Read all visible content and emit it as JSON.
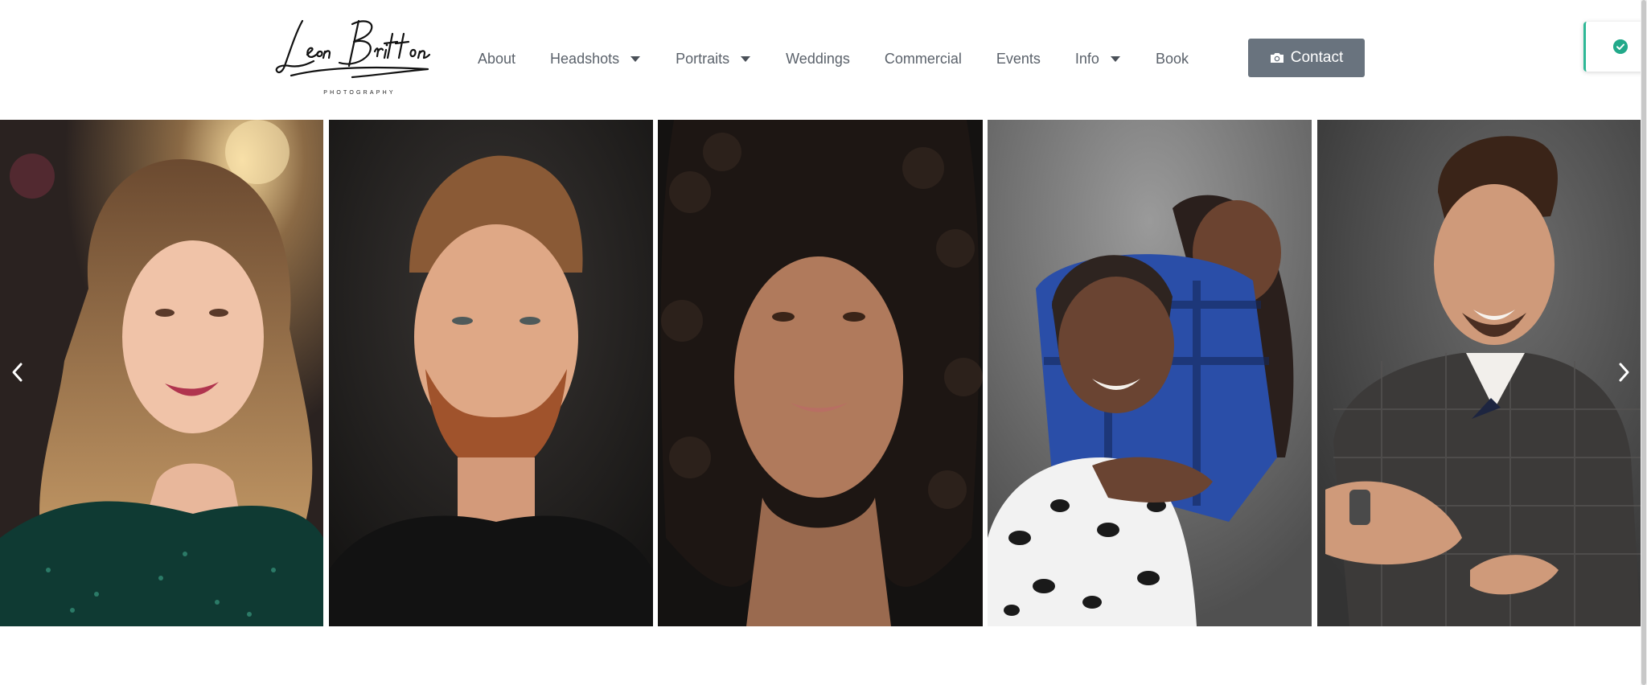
{
  "logo": {
    "name": "Leon Britton",
    "tagline": "PHOTOGRAPHY"
  },
  "nav": {
    "items": [
      {
        "label": "About",
        "dropdown": false
      },
      {
        "label": "Headshots",
        "dropdown": true
      },
      {
        "label": "Portraits",
        "dropdown": true
      },
      {
        "label": "Weddings",
        "dropdown": false
      },
      {
        "label": "Commercial",
        "dropdown": false
      },
      {
        "label": "Events",
        "dropdown": false
      },
      {
        "label": "Info",
        "dropdown": true
      },
      {
        "label": "Book",
        "dropdown": false
      }
    ]
  },
  "contact": {
    "label": "Contact",
    "icon": "camera-icon"
  },
  "toast": {
    "icon": "check-circle-icon",
    "accent": "#2eb896"
  },
  "gallery": {
    "photos": [
      {
        "name": "woman-green-sequin-portrait"
      },
      {
        "name": "man-red-beard-headshot"
      },
      {
        "name": "woman-curly-hair-headshot"
      },
      {
        "name": "mother-daughter-portrait"
      },
      {
        "name": "man-tweed-suit-portrait"
      }
    ],
    "prev_icon": "chevron-left-icon",
    "next_icon": "chevron-right-icon"
  },
  "colors": {
    "button_bg": "#69737e",
    "nav_text": "#5b626b",
    "accent": "#2eb896"
  }
}
